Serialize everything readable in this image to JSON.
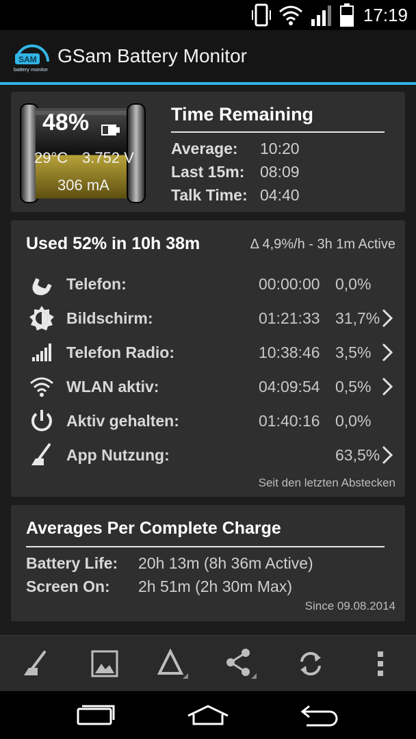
{
  "status_bar": {
    "time": "17:19",
    "icons": [
      "vibrate-icon",
      "wifi-icon",
      "signal-icon",
      "battery-icon"
    ]
  },
  "app_bar": {
    "logo_text": "SAM",
    "logo_subtext": "battery monitor",
    "title": "GSam Battery Monitor"
  },
  "battery": {
    "percent": "48%",
    "percent_level": 0.48,
    "temperature": "29°C",
    "voltage": "3.752 V",
    "current": "306 mA"
  },
  "time_remaining": {
    "title": "Time Remaining",
    "rows": [
      {
        "label": "Average:",
        "value": "10:20"
      },
      {
        "label": "Last 15m:",
        "value": "08:09"
      },
      {
        "label": "Talk Time:",
        "value": "04:40"
      }
    ]
  },
  "usage": {
    "title": "Used 52% in 10h 38m",
    "rate": "Δ 4,9%/h - 3h 1m Active",
    "rows": [
      {
        "icon": "phone-icon",
        "label": "Telefon:",
        "time": "00:00:00",
        "percent": "0,0%",
        "has_chevron": false
      },
      {
        "icon": "brightness-icon",
        "label": "Bildschirm:",
        "time": "01:21:33",
        "percent": "31,7%",
        "has_chevron": true
      },
      {
        "icon": "signal-bars-icon",
        "label": "Telefon Radio:",
        "time": "10:38:46",
        "percent": "3,5%",
        "has_chevron": true
      },
      {
        "icon": "wifi-icon",
        "label": "WLAN aktiv:",
        "time": "04:09:54",
        "percent": "0,5%",
        "has_chevron": true
      },
      {
        "icon": "power-icon",
        "label": "Aktiv gehalten:",
        "time": "01:40:16",
        "percent": "0,0%",
        "has_chevron": false
      },
      {
        "icon": "gauge-needle-icon",
        "label": "App Nutzung:",
        "time": "",
        "percent": "63,5%",
        "has_chevron": true
      }
    ],
    "footnote": "Seit den letzten Abstecken"
  },
  "averages": {
    "title": "Averages Per Complete Charge",
    "rows": [
      {
        "label": "Battery Life:",
        "value": "20h 13m (8h 36m Active)"
      },
      {
        "label": "Screen On:",
        "value": "2h 51m (2h 30m Max)"
      }
    ],
    "footnote": "Since 09.08.2014"
  },
  "toolbar": {
    "buttons": [
      "gauge-needle-icon",
      "image-icon",
      "delta-icon",
      "share-icon",
      "refresh-icon",
      "overflow-menu-icon"
    ]
  },
  "nav_bar": {
    "buttons": [
      "recent-apps-icon",
      "home-icon",
      "back-icon"
    ]
  },
  "colors": {
    "accent": "#33b5e5",
    "card": "#2f2f2f",
    "background": "#1c1c1c",
    "battery_fill": "#8c7a1e"
  }
}
